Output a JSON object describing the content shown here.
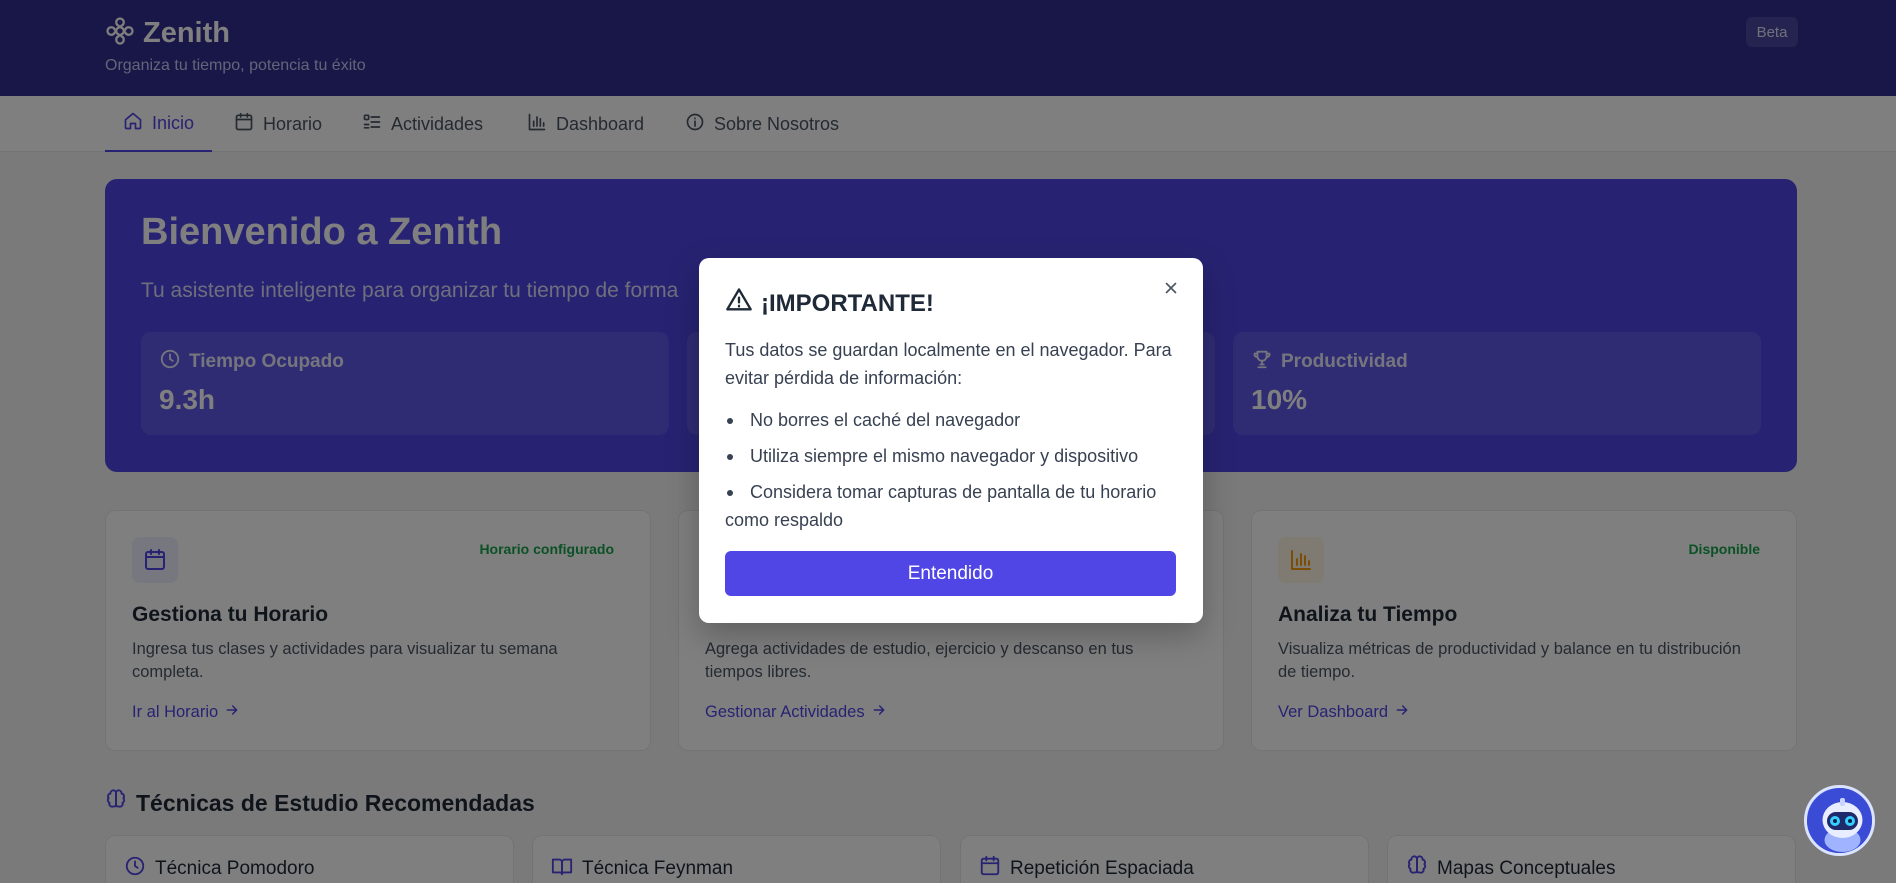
{
  "header": {
    "brand": "Zenith",
    "tagline": "Organiza tu tiempo, potencia tu éxito",
    "badge": "Beta"
  },
  "nav": {
    "tabs": [
      {
        "label": "Inicio",
        "icon": "home-icon",
        "active": true
      },
      {
        "label": "Horario",
        "icon": "calendar-icon",
        "active": false
      },
      {
        "label": "Actividades",
        "icon": "list-icon",
        "active": false
      },
      {
        "label": "Dashboard",
        "icon": "bar-chart-icon",
        "active": false
      },
      {
        "label": "Sobre Nosotros",
        "icon": "info-icon",
        "active": false
      }
    ]
  },
  "hero": {
    "title": "Bienvenido a Zenith",
    "subtitle": "Tu asistente inteligente para organizar tu tiempo de forma",
    "stats": [
      {
        "label": "Tiempo Ocupado",
        "value": "9.3h",
        "icon": "clock-icon"
      },
      {
        "label": "",
        "value": "",
        "icon": ""
      },
      {
        "label": "Productividad",
        "value": "10%",
        "icon": "trophy-icon"
      }
    ]
  },
  "cards": [
    {
      "title": "Gestiona tu Horario",
      "badge": "Horario configurado",
      "description": "Ingresa tus clases y actividades para visualizar tu semana completa.",
      "link": "Ir al Horario",
      "icon": "calendar-icon"
    },
    {
      "title": "",
      "badge": "",
      "description": "Agrega actividades de estudio, ejercicio y descanso en tus tiempos libres.",
      "link": "Gestionar Actividades",
      "icon": ""
    },
    {
      "title": "Analiza tu Tiempo",
      "badge": "Disponible",
      "description": "Visualiza métricas de productividad y balance en tu distribución de tiempo.",
      "link": "Ver Dashboard",
      "icon": "bar-chart-icon"
    }
  ],
  "techniques": {
    "title": "Técnicas de Estudio Recomendadas",
    "items": [
      {
        "label": "Técnica Pomodoro",
        "icon": "clock-icon"
      },
      {
        "label": "Técnica Feynman",
        "icon": "book-icon"
      },
      {
        "label": "Repetición Espaciada",
        "icon": "calendar-icon"
      },
      {
        "label": "Mapas Conceptuales",
        "icon": "brain-icon"
      }
    ]
  },
  "modal": {
    "title": "¡IMPORTANTE!",
    "intro": "Tus datos se guardan localmente en el navegador. Para evitar pérdida de información:",
    "items": [
      "No borres el caché del navegador",
      "Utiliza siempre el mismo navegador y dispositivo",
      "Considera tomar capturas de pantalla de tu horario como respaldo"
    ],
    "button": "Entendido"
  },
  "colors": {
    "brand": "#312e91",
    "accent": "#4f46e5",
    "success": "#16a34a",
    "warning_icon": "#f59e0b"
  }
}
